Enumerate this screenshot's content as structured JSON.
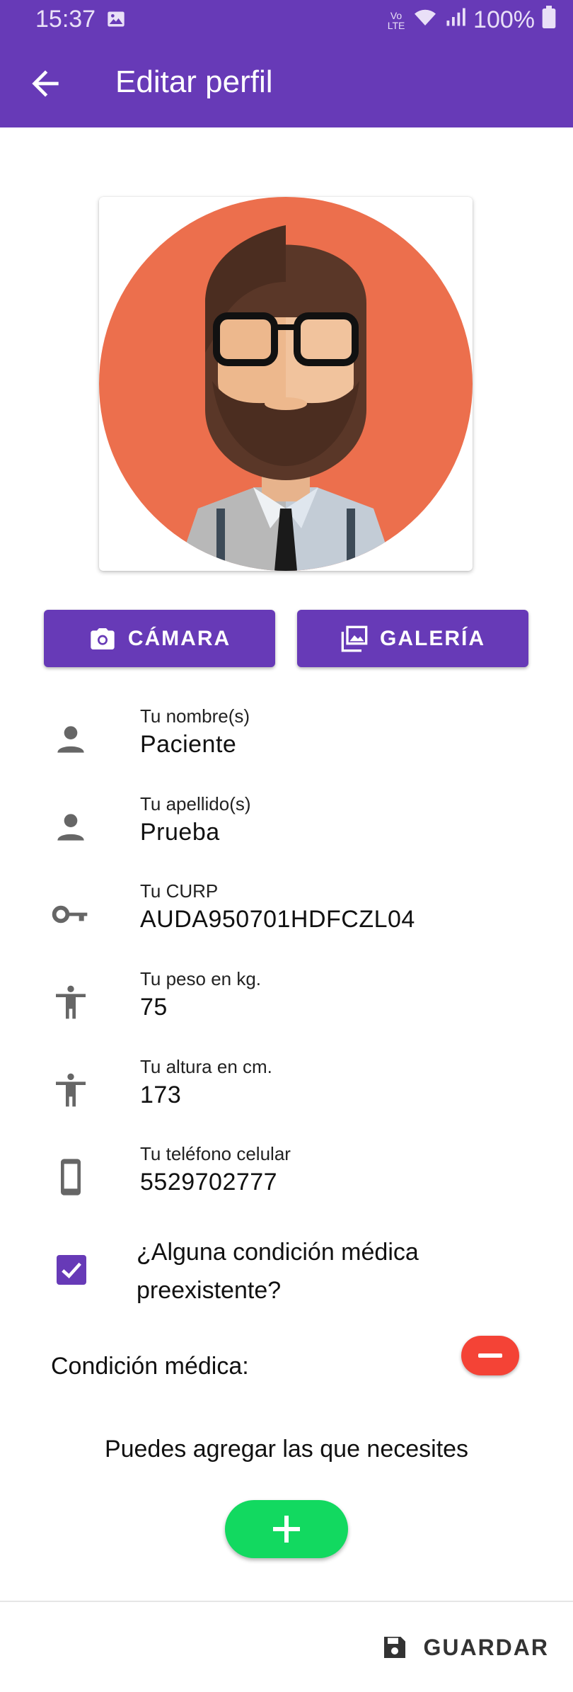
{
  "status_bar": {
    "time": "15:37",
    "battery": "100%",
    "network_label": "Vo LTE"
  },
  "app_bar": {
    "title": "Editar perfil"
  },
  "photo_buttons": {
    "camera_label": "CÁMARA",
    "gallery_label": "GALERÍA"
  },
  "fields": [
    {
      "label": "Tu nombre(s)",
      "value": "Paciente",
      "icon": "person-icon"
    },
    {
      "label": "Tu apellido(s)",
      "value": "Prueba",
      "icon": "person-icon"
    },
    {
      "label": "Tu CURP",
      "value": "AUDA950701HDFCZL04",
      "icon": "key-icon"
    },
    {
      "label": "Tu peso en kg.",
      "value": "75",
      "icon": "accessibility-icon"
    },
    {
      "label": "Tu altura en cm.",
      "value": "173",
      "icon": "accessibility-icon"
    },
    {
      "label": "Tu teléfono celular",
      "value": "5529702777",
      "icon": "phone-icon"
    }
  ],
  "preexisting": {
    "label": "¿Alguna condición médica preexistente?",
    "checked": true
  },
  "condition": {
    "label": "Condición médica:",
    "helper": "Puedes agregar las que necesites"
  },
  "footer": {
    "save_label": "GUARDAR"
  },
  "colors": {
    "primary": "#673ab7",
    "danger": "#f44336",
    "success": "#12d960"
  }
}
